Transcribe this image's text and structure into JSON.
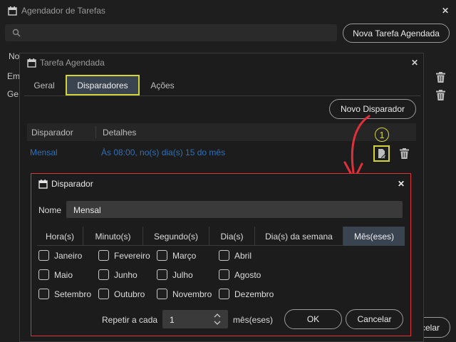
{
  "main": {
    "title": "Agendador de Tarefas",
    "new_task_button": "Nova Tarefa Agendada",
    "col_name_partial": "No",
    "row1_partial": "Em",
    "row2_partial": "Ge",
    "cancel_partial": "celar"
  },
  "task": {
    "title": "Tarefa Agendada",
    "tabs": [
      "Geral",
      "Disparadores",
      "Ações"
    ],
    "new_trigger_button": "Novo Disparador",
    "columns": [
      "Disparador",
      "Detalhes"
    ],
    "row": {
      "trigger": "Mensal",
      "details": "Às 08:00, no(s) dia(s) 15 do mês"
    },
    "step_badge": "1"
  },
  "trigger_dialog": {
    "title": "Disparador",
    "name_label": "Nome",
    "name_value": "Mensal",
    "tabs": [
      "Hora(s)",
      "Minuto(s)",
      "Segundo(s)",
      "Dia(s)",
      "Dia(s) da semana",
      "Mês(eses)"
    ],
    "months": [
      "Janeiro",
      "Fevereiro",
      "Março",
      "Abril",
      "Maio",
      "Junho",
      "Julho",
      "Agosto",
      "Setembro",
      "Outubro",
      "Novembro",
      "Dezembro"
    ],
    "repeat_label": "Repetir a cada",
    "repeat_value": "1",
    "repeat_unit": "mês(eses)",
    "ok": "OK",
    "cancel": "Cancelar"
  },
  "colors": {
    "highlight_yellow": "#d4d43a",
    "annotation_red": "#e0303a",
    "link_blue": "#2f6fb5",
    "active_tab_bg": "#3a4350"
  }
}
